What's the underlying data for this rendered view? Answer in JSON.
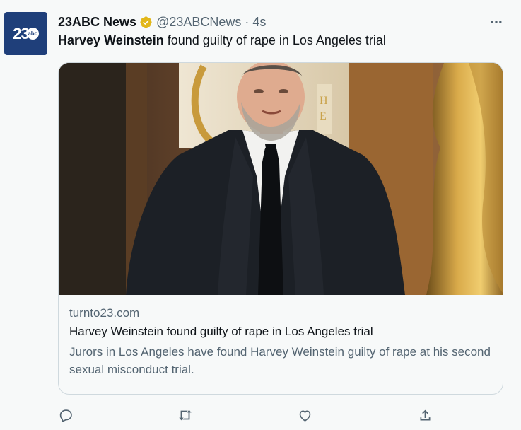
{
  "tweet": {
    "avatar": {
      "number": "23",
      "badge": "abc"
    },
    "author_name": "23ABC News",
    "handle": "@23ABCNews",
    "separator": "·",
    "time": "4s",
    "text_bold": "Harvey Weinstein",
    "text_rest": " found guilty of rape in Los Angeles trial"
  },
  "card": {
    "domain": "turnto23.com",
    "title": "Harvey Weinstein found guilty of rape in Los Angeles trial",
    "description": "Jurors in Los Angeles have found Harvey Weinstein guilty of rape at his second sexual misconduct trial."
  },
  "icons": {
    "verified": "verified-badge-icon",
    "more": "more-icon",
    "reply": "reply-icon",
    "retweet": "retweet-icon",
    "like": "like-icon",
    "share": "share-icon"
  },
  "colors": {
    "background": "#f7f9f9",
    "text_primary": "#0f1419",
    "text_secondary": "#536471",
    "border": "#cfd9de",
    "verified_gold": "#e2b719",
    "avatar_blue": "#1f3f7a"
  }
}
